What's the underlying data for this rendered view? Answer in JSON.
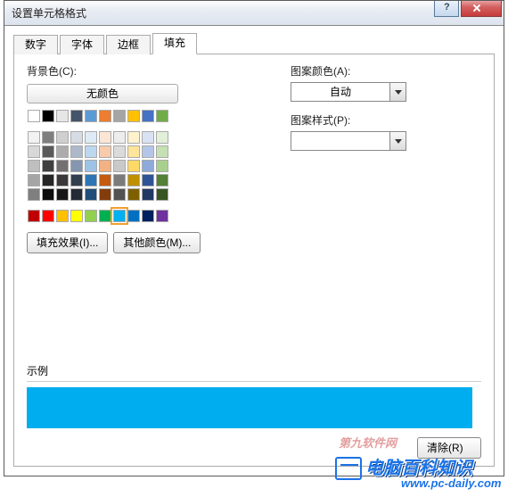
{
  "title": "设置单元格格式",
  "tabs": [
    "数字",
    "字体",
    "边框",
    "填充"
  ],
  "active_tab": 3,
  "labels": {
    "background": "背景色(C):",
    "no_color": "无颜色",
    "fill_effects": "填充效果(I)...",
    "other_colors": "其他颜色(M)...",
    "pattern_color": "图案颜色(A):",
    "pattern_auto": "自动",
    "pattern_style": "图案样式(P):",
    "example": "示例",
    "clear": "清除(R)"
  },
  "combo": {
    "pattern_color_value": "自动",
    "pattern_style_value": ""
  },
  "example_color": "#00aeef",
  "palette": {
    "row1": [
      "#ffffff",
      "#000000",
      "#e7e6e6",
      "#44546a",
      "#5b9bd5",
      "#ed7d31",
      "#a5a5a5",
      "#ffc000",
      "#4472c4",
      "#70ad47"
    ],
    "theme": [
      [
        "#f2f2f2",
        "#7f7f7f",
        "#d0cece",
        "#d6dce4",
        "#deebf6",
        "#fbe5d5",
        "#ededed",
        "#fff2cc",
        "#d9e2f3",
        "#e2efd9"
      ],
      [
        "#d8d8d8",
        "#595959",
        "#aeabab",
        "#adb9ca",
        "#bdd7ee",
        "#f7cbac",
        "#dbdbdb",
        "#fee599",
        "#b4c6e7",
        "#c5e0b3"
      ],
      [
        "#bfbfbf",
        "#3f3f3f",
        "#757070",
        "#8496b0",
        "#9cc3e5",
        "#f4b183",
        "#c9c9c9",
        "#ffd965",
        "#8eaadb",
        "#a8d08d"
      ],
      [
        "#a5a5a5",
        "#262626",
        "#3a3838",
        "#323f4f",
        "#2e75b5",
        "#c55a11",
        "#7b7b7b",
        "#bf9000",
        "#2f5496",
        "#538135"
      ],
      [
        "#7f7f7f",
        "#0c0c0c",
        "#171616",
        "#222a35",
        "#1e4e79",
        "#833c0b",
        "#525252",
        "#7f6000",
        "#1f3864",
        "#375623"
      ]
    ],
    "standard": [
      "#c00000",
      "#ff0000",
      "#ffc000",
      "#ffff00",
      "#92d050",
      "#00b050",
      "#00b0f0",
      "#0070c0",
      "#002060",
      "#7030a0"
    ],
    "selected_standard_index": 6
  },
  "watermark": {
    "line1": "第九软件网",
    "line2": "电脑百科知识",
    "line3": "www.pc-daily.com"
  }
}
